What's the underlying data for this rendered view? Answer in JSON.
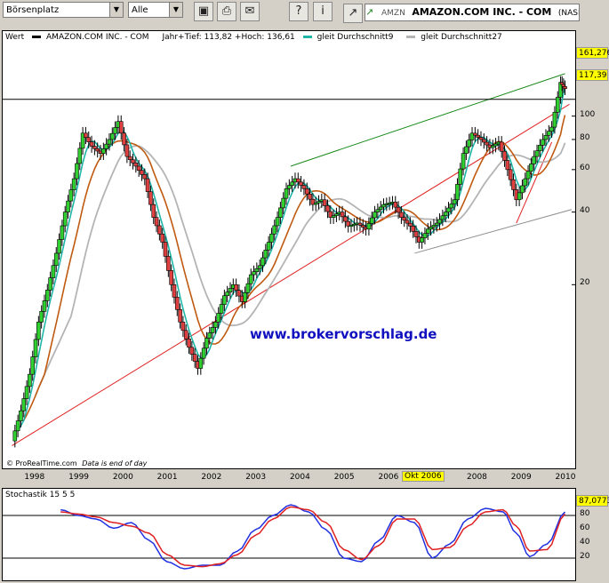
{
  "toolbar": {
    "exchange_label": "Börsenplatz",
    "filter_label": "Alle",
    "symbol": "AMZN",
    "company": "AMAZON.COM INC. - COM",
    "exchange": "(NASDAQ"
  },
  "colors": {
    "bull": "#2fd02f",
    "bear": "#e04040",
    "ma9": "#1fb6a8",
    "ma27": "#b4b4b4",
    "ma_extra": "#c05a10",
    "trend_support": "#e02020",
    "trend_upper": "#1a8a1a",
    "trend_gray": "#909090",
    "stoch_k": "#2030e0",
    "stoch_d": "#e02020",
    "watermark": "#1010c0"
  },
  "main_panel": {
    "legend_wert": "Wert",
    "legend_name": "AMAZON.COM  INC. - COM",
    "legend_range": "Jahr+Tief: 113,82 +Hoch: 136,61",
    "legend_ma9": "gleit Durchschnitt9",
    "legend_ma27": "gleit Durchschnitt27",
    "last_price_tag": "161,276",
    "line_tag": "117,39",
    "watermark": "www.brokervorschlag.de",
    "credit": "© ProRealTime.com",
    "credit_note": "Data is end of day",
    "highlight_label": "Okt 2006"
  },
  "stoch_panel": {
    "title": "Stochastik 15 5 5",
    "value_tag": "87,0773"
  },
  "chart_data": [
    {
      "type": "candlestick",
      "scale": "log",
      "ylim": [
        4.0,
        190
      ],
      "y_ticks": [
        20,
        40,
        60,
        80,
        100
      ],
      "x_ticks": [
        "1998",
        "1999",
        "2000",
        "2001",
        "2002",
        "2003",
        "2004",
        "2005",
        "2006",
        "2008",
        "2009",
        "2010"
      ],
      "grid": false,
      "series": [
        {
          "name": "AMAZON.COM  INC. - COM",
          "kind": "monthly-close",
          "x": [
            1997.5,
            1997.7,
            1997.9,
            1998.1,
            1998.3,
            1998.5,
            1998.7,
            1998.9,
            1999.1,
            1999.3,
            1999.5,
            1999.7,
            1999.9,
            2000.1,
            2000.3,
            2000.5,
            2000.7,
            2000.9,
            2001.1,
            2001.3,
            2001.5,
            2001.7,
            2001.9,
            2002.1,
            2002.3,
            2002.5,
            2002.7,
            2002.9,
            2003.1,
            2003.3,
            2003.5,
            2003.7,
            2003.9,
            2004.1,
            2004.3,
            2004.5,
            2004.7,
            2004.9,
            2005.1,
            2005.3,
            2005.5,
            2005.7,
            2005.9,
            2006.1,
            2006.3,
            2006.5,
            2006.7,
            2006.9,
            2007.1,
            2007.3,
            2007.5,
            2007.7,
            2007.9,
            2008.1,
            2008.3,
            2008.5,
            2008.7,
            2008.9,
            2009.1,
            2009.3,
            2009.5,
            2009.7,
            2009.9,
            2010.0
          ],
          "y": [
            4.5,
            6.0,
            8.5,
            14,
            19,
            27,
            40,
            55,
            85,
            75,
            70,
            80,
            95,
            68,
            62,
            55,
            38,
            30,
            20,
            14,
            11,
            9,
            12,
            14,
            18,
            20,
            17,
            22,
            24,
            30,
            38,
            50,
            55,
            50,
            43,
            45,
            38,
            40,
            35,
            36,
            34,
            40,
            43,
            44,
            38,
            35,
            30,
            34,
            36,
            40,
            45,
            70,
            85,
            80,
            74,
            78,
            60,
            45,
            55,
            68,
            80,
            90,
            138,
            130
          ]
        }
      ],
      "moving_averages": [
        {
          "name": "gleit Durchschnitt9"
        },
        {
          "name": "gleit Durchschnitt27"
        }
      ],
      "annotations": [
        "161,276",
        "117,39",
        "Okt 2006"
      ]
    },
    {
      "type": "line",
      "title": "Stochastik 15 5 5",
      "ylim": [
        0,
        100
      ],
      "y_ticks": [
        20,
        40,
        60,
        80
      ],
      "reference_lines": [
        20,
        80
      ],
      "series": [
        {
          "kind": "k",
          "x": [
            1998.6,
            1999.0,
            1999.4,
            1999.8,
            2000.2,
            2000.6,
            2001.0,
            2001.4,
            2001.8,
            2002.2,
            2002.6,
            2003.0,
            2003.4,
            2003.8,
            2004.2,
            2004.6,
            2005.0,
            2005.4,
            2005.8,
            2006.2,
            2006.6,
            2007.0,
            2007.4,
            2007.8,
            2008.2,
            2008.6,
            2008.9,
            2009.2,
            2009.6,
            2010.0
          ],
          "y": [
            88,
            80,
            75,
            62,
            70,
            45,
            15,
            5,
            10,
            10,
            30,
            60,
            80,
            95,
            85,
            60,
            20,
            15,
            45,
            80,
            70,
            20,
            40,
            75,
            90,
            85,
            55,
            22,
            40,
            85
          ]
        },
        {
          "kind": "d",
          "x": [
            1998.6,
            1999.0,
            1999.4,
            1999.8,
            2000.2,
            2000.6,
            2001.0,
            2001.4,
            2001.8,
            2002.2,
            2002.6,
            2003.0,
            2003.4,
            2003.8,
            2004.2,
            2004.6,
            2005.0,
            2005.4,
            2005.8,
            2006.2,
            2006.6,
            2007.0,
            2007.4,
            2007.8,
            2008.2,
            2008.6,
            2008.9,
            2009.2,
            2009.6,
            2010.0
          ],
          "y": [
            85,
            82,
            78,
            70,
            65,
            55,
            25,
            10,
            8,
            12,
            25,
            52,
            75,
            92,
            88,
            70,
            32,
            18,
            38,
            75,
            75,
            32,
            35,
            65,
            85,
            88,
            65,
            30,
            32,
            82
          ]
        }
      ],
      "annotations": [
        "87,0773"
      ]
    }
  ]
}
